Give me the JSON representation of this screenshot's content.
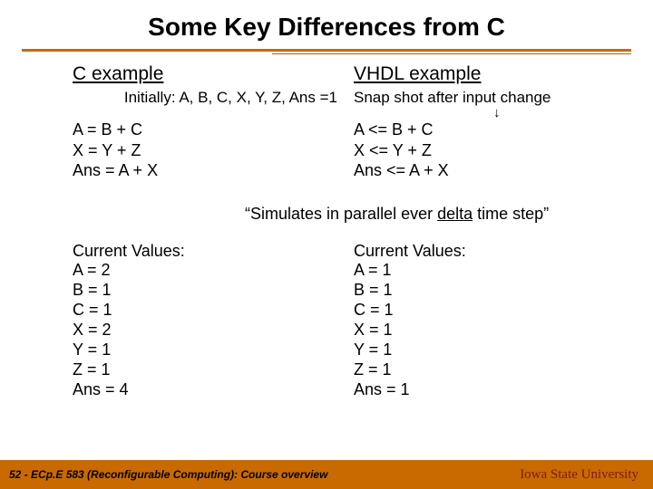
{
  "title": "Some Key Differences from C",
  "headings": {
    "c": "C example",
    "vhdl": "VHDL example"
  },
  "initial_label": "Initially: A, B, C, X, Y, Z, Ans =1",
  "snapshot_label": "Snap shot after input change",
  "c_code": {
    "l1": "A = B + C",
    "l2": "X = Y + Z",
    "l3": "Ans = A + X"
  },
  "vhdl_code": {
    "l1": "A <= B + C",
    "l2": "X <= Y + Z",
    "l3": "Ans <= A + X"
  },
  "sim_quote_pre": "“Simulates in parallel ever ",
  "sim_quote_delta": "delta",
  "sim_quote_post": " time step”",
  "c_values": {
    "header": "Current Values:",
    "a": "A = 2",
    "b": "B = 1",
    "c": "C = 1",
    "x": "X = 2",
    "y": "Y = 1",
    "z": "Z = 1",
    "ans": "Ans = 4"
  },
  "vhdl_values": {
    "header": "Current Values:",
    "a": "A = 1",
    "b": "B = 1",
    "c": "C = 1",
    "x": "X = 1",
    "y": "Y = 1",
    "z": "Z = 1",
    "ans": "Ans = 1"
  },
  "footer": {
    "slide_num": "52",
    "course": " - ECp.E 583 (Reconfigurable Computing): Course overview",
    "university": "Iowa State University"
  },
  "arrow_glyph": "↓"
}
